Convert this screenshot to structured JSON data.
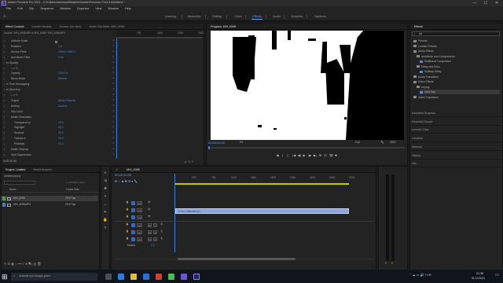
{
  "window": {
    "title": "Adobe Premiere Pro 2021 - C:\\Kullanıcılar\\umutt\\Belgeler\\Adobe\\Premiere Pro\\14.0\\Untitled *",
    "app_icon_text": "Pr",
    "controls": [
      "—",
      "☐",
      "✕"
    ]
  },
  "menu": [
    "File",
    "Edit",
    "Clip",
    "Sequence",
    "Markers",
    "Graphics",
    "View",
    "Window",
    "Help"
  ],
  "workspaces": [
    "Learning",
    "Assembly",
    "Editing",
    "Color",
    "Effects",
    "Audio",
    "Graphics",
    "Captions"
  ],
  "active_workspace": "Effects",
  "effect_controls": {
    "tabs": [
      "Effect Controls",
      "Lumetri Scopes",
      "Source: (no clips)",
      "Audio Clip Mixer: MVI_0098"
    ],
    "source_line": "Source * MVI_0098.MP4 ▾  MVI_0098 * MVI_0098.MP4",
    "ruler": [
      "750",
      "1500",
      "2250",
      "3000"
    ],
    "rows": [
      {
        "indent": 10,
        "label": "Uniform Scale",
        "value": "",
        "check": true
      },
      {
        "indent": 10,
        "label": "Rotation",
        "value": "0.0",
        "check": false
      },
      {
        "indent": 10,
        "label": "Anchor Point",
        "value": "1920.0    1080.0",
        "check": false
      },
      {
        "indent": 10,
        "label": "Anti-flicker Filter",
        "value": "0.00",
        "check": false
      },
      {
        "indent": 4,
        "label": "fx  Opacity",
        "value": "",
        "check": false
      },
      {
        "indent": 10,
        "label": "○ □ ✎",
        "value": "",
        "check": false
      },
      {
        "indent": 10,
        "label": "Opacity",
        "value": "100.0 %",
        "check": false
      },
      {
        "indent": 10,
        "label": "Blend Mode",
        "value": "Normal",
        "check": false
      },
      {
        "indent": 4,
        "label": "fx  Time Remapping",
        "value": "",
        "check": false
      },
      {
        "indent": 4,
        "label": "fx  Ultra Key",
        "value": "",
        "check": false
      },
      {
        "indent": 10,
        "label": "○ □ ✎",
        "value": "",
        "check": false
      },
      {
        "indent": 10,
        "label": "Output",
        "value": "Alpha Channel",
        "check": false
      },
      {
        "indent": 10,
        "label": "Setting",
        "value": "Custom",
        "check": false
      },
      {
        "indent": 10,
        "label": "Key Color",
        "value": "",
        "check": false
      },
      {
        "indent": 10,
        "label": "Matte Generation",
        "value": "",
        "check": false
      },
      {
        "indent": 14,
        "label": "Transparency",
        "value": "29.0",
        "check": false
      },
      {
        "indent": 14,
        "label": "Highlight",
        "value": "40.0",
        "check": false
      },
      {
        "indent": 14,
        "label": "Shadow",
        "value": "29.0",
        "check": false
      },
      {
        "indent": 14,
        "label": "Tolerance",
        "value": "20.0",
        "check": false
      },
      {
        "indent": 14,
        "label": "Pedestal",
        "value": "10.0",
        "check": false
      },
      {
        "indent": 10,
        "label": "Matte Cleanup",
        "value": "",
        "check": false
      },
      {
        "indent": 10,
        "label": "Spill Suppression",
        "value": "",
        "check": false
      }
    ],
    "bottom_timecode": "0:00:00:00"
  },
  "program": {
    "tab": "Program: MVI_0098",
    "timecode": "00;00;00;00",
    "fit": "Fit",
    "quality": "Full",
    "duration": "3337",
    "controls": [
      "◆",
      "{",
      "}",
      "|◀",
      "◀|",
      "▶",
      "|▶",
      "▶|",
      "⊞",
      "⊟",
      "📷",
      "✚"
    ]
  },
  "effects_panel": {
    "tab": "Effects",
    "search_value": "ult",
    "items": [
      {
        "indent": 0,
        "label": "Presets",
        "folder": true
      },
      {
        "indent": 0,
        "label": "Lumetri Presets",
        "folder": true
      },
      {
        "indent": 0,
        "label": "Audio Effects",
        "folder": true
      },
      {
        "indent": 4,
        "label": "Amplitude and Compression",
        "folder": true
      },
      {
        "indent": 8,
        "label": "Multiband Compressor",
        "folder": false
      },
      {
        "indent": 4,
        "label": "Delay and Echo",
        "folder": true
      },
      {
        "indent": 8,
        "label": "Multitap Delay",
        "folder": false
      },
      {
        "indent": 0,
        "label": "Audio Transitions",
        "folder": true
      },
      {
        "indent": 0,
        "label": "Video Effects",
        "folder": true
      },
      {
        "indent": 4,
        "label": "Keying",
        "folder": true
      },
      {
        "indent": 8,
        "label": "Ultra Key",
        "folder": false,
        "selected": true
      },
      {
        "indent": 0,
        "label": "Video Transitions",
        "folder": true
      }
    ],
    "sections": [
      "Essential Graphics",
      "Essential Sound",
      "Lumetri Color",
      "Libraries",
      "Markers",
      "History",
      "Info"
    ]
  },
  "project": {
    "tabs": [
      "Project: Untitled",
      "Media Browser"
    ],
    "file": "Untitled.prproj",
    "count": "1 of 2 items selec...",
    "columns": [
      "Name",
      "Frame Rate"
    ],
    "items": [
      {
        "name": "MVI_0098",
        "rate": "29.97 fps",
        "color": "#4c9e57",
        "selected": true
      },
      {
        "name": "MVI_0098.MP4",
        "rate": "29.97 fps",
        "color": "#4b7bc4",
        "selected": false
      }
    ]
  },
  "timeline": {
    "tab": "MVI_0098",
    "timecode": "00;00;00;00",
    "ruler": [
      "375",
      "750",
      "1125",
      "1500",
      "1875",
      "2250",
      "2625",
      "3000",
      "3375"
    ],
    "video_tracks": [
      "V3",
      "V2",
      "V1"
    ],
    "audio_tracks": [
      "A1",
      "A2",
      "A3"
    ],
    "master": "Master",
    "master_value": "0.0",
    "clip_label": "fx  MVI_0098.MP4[V]"
  },
  "meter": {
    "labels": [
      "0",
      "0"
    ]
  },
  "taskbar": {
    "search_placeholder": "Aramak için buraya yazın",
    "time": "21:38",
    "date": "31.10.2021"
  }
}
